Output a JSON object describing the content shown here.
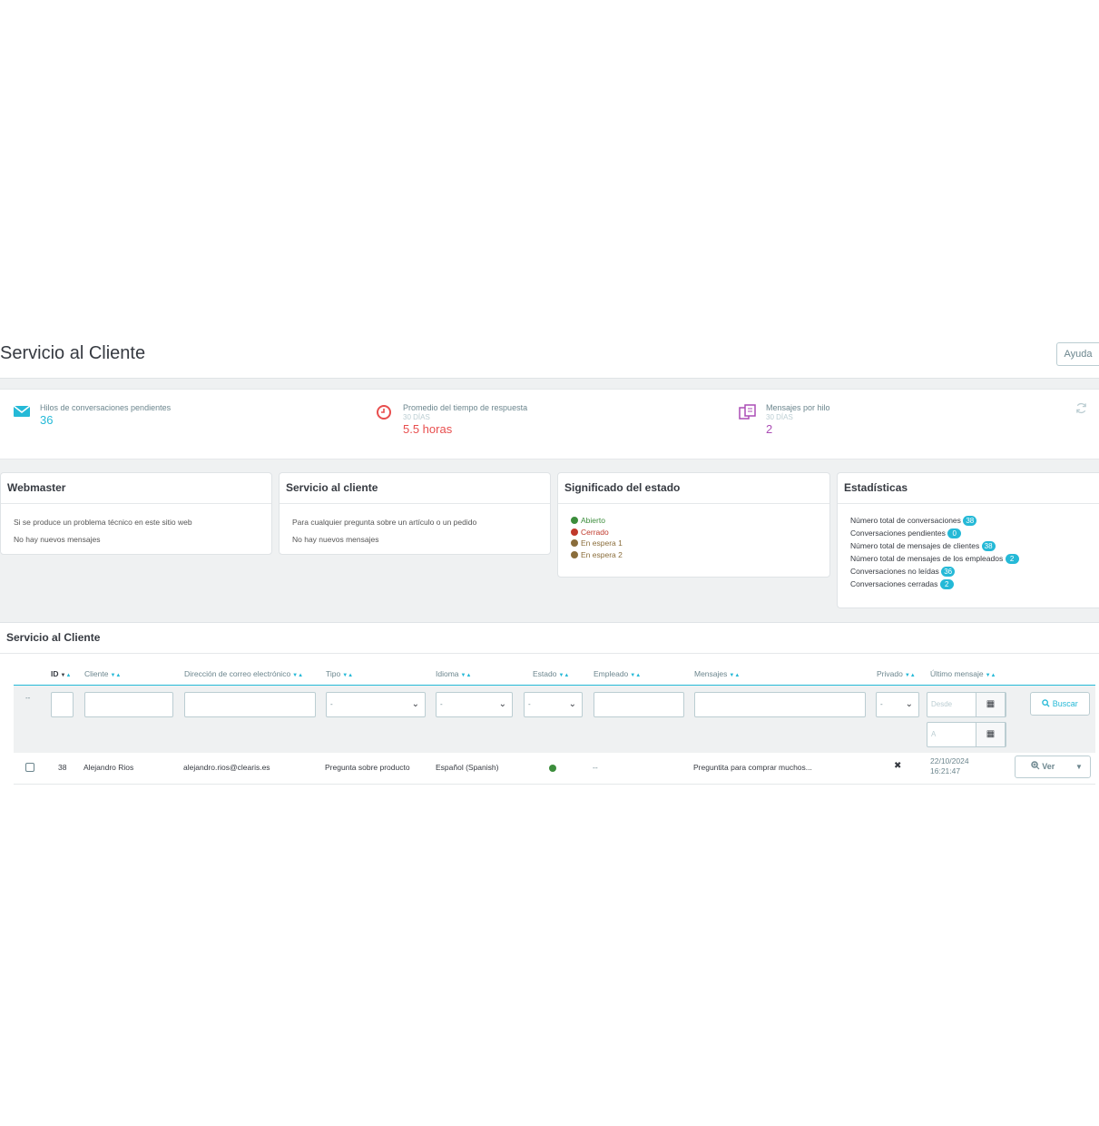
{
  "header": {
    "title": "Servicio al Cliente",
    "help_label": "Ayuda"
  },
  "kpis": [
    {
      "title": "Hilos de conversaciones pendientes",
      "subtitle": "",
      "value": "36",
      "color": "#25b9d7",
      "icon": "envelope-icon"
    },
    {
      "title": "Promedio del tiempo de respuesta",
      "subtitle": "30 días",
      "value": "5.5 horas",
      "color": "#e84e4e",
      "icon": "clock-icon"
    },
    {
      "title": "Mensajes por hilo",
      "subtitle": "30 días",
      "value": "2",
      "color": "#ab4db5",
      "icon": "copy-icon"
    }
  ],
  "panels": {
    "webmaster": {
      "title": "Webmaster",
      "line1": "Si se produce un problema técnico en este sitio web",
      "line2": "No hay nuevos mensajes"
    },
    "service": {
      "title": "Servicio al cliente",
      "line1": "Para cualquier pregunta sobre un artículo o un pedido",
      "line2": "No hay nuevos mensajes"
    },
    "legend": {
      "title": "Significado del estado",
      "items": [
        {
          "label": "Abierto",
          "color": "#3c8d3c",
          "text_color": "#3c8d3c"
        },
        {
          "label": "Cerrado",
          "color": "#c0392b",
          "text_color": "#c0392b"
        },
        {
          "label": "En espera 1",
          "color": "#8a6d3b",
          "text_color": "#8a6d3b"
        },
        {
          "label": "En espera 2",
          "color": "#8a6d3b",
          "text_color": "#8a6d3b"
        }
      ]
    },
    "stats": {
      "title": "Estadísticas",
      "items": [
        {
          "label": "Número total de conversaciones",
          "value": "38"
        },
        {
          "label": "Conversaciones pendientes",
          "value": "0"
        },
        {
          "label": "Número total de mensajes de clientes",
          "value": "38"
        },
        {
          "label": "Número total de mensajes de los empleados",
          "value": "2"
        },
        {
          "label": "Conversaciones no leídas",
          "value": "36"
        },
        {
          "label": "Conversaciones cerradas",
          "value": "2"
        }
      ]
    }
  },
  "list": {
    "title": "Servicio al Cliente",
    "columns": {
      "id": "ID",
      "cliente": "Cliente",
      "email": "Dirección de correo electrónico",
      "tipo": "Tipo",
      "idioma": "Idioma",
      "estado": "Estado",
      "empleado": "Empleado",
      "mensajes": "Mensajes",
      "privado": "Privado",
      "ultimo": "Último mensaje"
    },
    "filters": {
      "bulk": "--",
      "select_default": "-",
      "date_from_placeholder": "Desde",
      "date_to_placeholder": "A",
      "search_label": "Buscar"
    },
    "rows": [
      {
        "id": "38",
        "cliente": "Alejandro Rios",
        "email": "alejandro.rios@clearis.es",
        "tipo": "Pregunta sobre producto",
        "idioma": "Español (Spanish)",
        "estado_color": "#3c8d3c",
        "empleado": "--",
        "mensajes": "Preguntita para comprar muchos...",
        "privado": "✖",
        "fecha": "22/10/2024",
        "hora": "16:21:47",
        "view_label": "Ver"
      }
    ]
  }
}
